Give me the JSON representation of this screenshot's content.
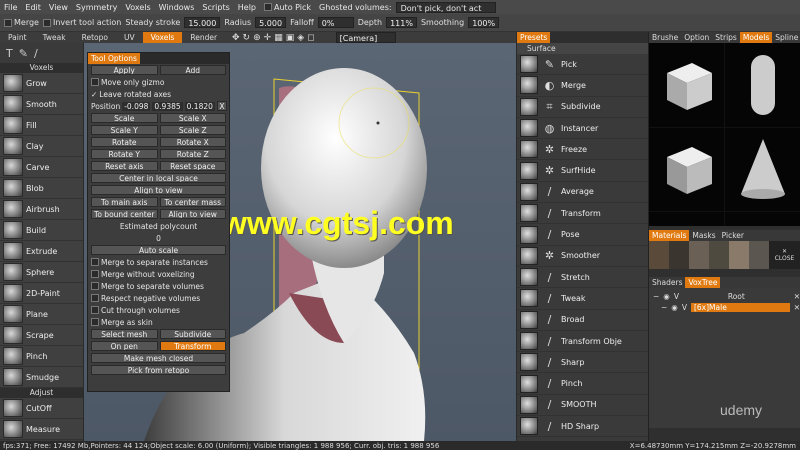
{
  "menu": [
    "File",
    "Edit",
    "View",
    "Symmetry",
    "Voxels",
    "Windows",
    "Scripts",
    "Help",
    "Auto Pick",
    "Ghosted volumes:",
    "Don't pick, don't act"
  ],
  "toolbar": {
    "merge": "Merge",
    "invert": "Invert tool action",
    "steady": "Steady stroke",
    "steady_val": "15.000",
    "radius": "Radius",
    "radius_val": "5.000",
    "falloff": "Falloff",
    "falloff_val": "0%",
    "depth": "Depth",
    "depth_val": "111%",
    "smoothing": "Smoothing",
    "smoothing_val": "100%"
  },
  "rooms": [
    "Paint",
    "Tweak",
    "Retopo",
    "UV",
    "Voxels",
    "Render"
  ],
  "camera": "[Camera]",
  "left": {
    "header": "Voxels",
    "tools": [
      "Grow",
      "Smooth",
      "Fill",
      "Clay",
      "Carve",
      "Blob",
      "Airbrush",
      "Build",
      "Extrude",
      "Sphere",
      "2D-Paint",
      "Plane",
      "Scrape",
      "Pinch",
      "Smudge"
    ],
    "adjust": "Adjust",
    "adjust_tools": [
      "CutOff",
      "Measure"
    ]
  },
  "toolopts": {
    "title": "Tool Options",
    "apply": "Apply",
    "add": "Add",
    "move_gizmo": "Move only gizmo",
    "leave_rot": "Leave rotated axes",
    "position": "Position",
    "px": "-0.098",
    "py": "0.9385",
    "pz": "0.1820",
    "x": "X",
    "scale": "Scale",
    "scale_x": "Scale X",
    "scale_y": "Scale Y",
    "scale_z": "Scale Z",
    "rotate": "Rotate",
    "rotate_x": "Rotate X",
    "rotate_y": "Rotate Y",
    "rotate_z": "Rotate Z",
    "reset_axis": "Reset axis",
    "reset_space": "Reset space",
    "center_local": "Center in local space",
    "align_view": "Align to view",
    "to_main_axis": "To main axis",
    "to_center_mass": "To center mass",
    "to_bound_center": "To bound center",
    "align_to_view": "Align to view",
    "est_poly": "Estimated polycount",
    "est_val": "0",
    "auto_scale": "Auto scale",
    "checks": [
      "Merge to separate instances",
      "Merge without voxelizing",
      "Merge to separate volumes",
      "Respect negative volumes",
      "Cut through volumes",
      "Merge as skin"
    ],
    "select_mesh": "Select mesh",
    "subdivide": "Subdivide",
    "on_pen": "On pen",
    "transform": "Transform",
    "make_closed": "Make mesh closed",
    "pick_retopo": "Pick from retopo"
  },
  "presets": {
    "tab": "Presets",
    "section": "Surface",
    "items": [
      "Pick",
      "Merge",
      "Subdivide",
      "Instancer",
      "Freeze",
      "SurfHide",
      "Average",
      "Transform",
      "Pose",
      "Smoother",
      "Stretch",
      "Tweak",
      "Broad",
      "Transform Obje",
      "Sharp",
      "Pinch",
      "SMOOTH",
      "HD Sharp"
    ]
  },
  "models": {
    "tabs": [
      "Brushe",
      "Option",
      "Strips",
      "Models",
      "Spline"
    ],
    "mat_tabs": [
      "Materials",
      "Masks",
      "Picker"
    ],
    "close": "CLOSE",
    "shader_tabs": [
      "Shaders",
      "VoxTree"
    ],
    "tree": [
      {
        "label": "Root"
      },
      {
        "label": "[6x]Male"
      }
    ]
  },
  "status": "fps:371;  Free: 17492 Mb,Pointers: 44 124;Object scale: 6.00 (Uniform); Visible triangles: 1 988 956; Curr. obj. tris: 1 988 956",
  "coords": "X=6.48730mm Y=174.215mm Z=-20.9278mm",
  "watermark": "www.cgtsj.com",
  "brand": "udemy",
  "colors": {
    "accent": "#e07a10",
    "watermark": "#ffff22"
  }
}
